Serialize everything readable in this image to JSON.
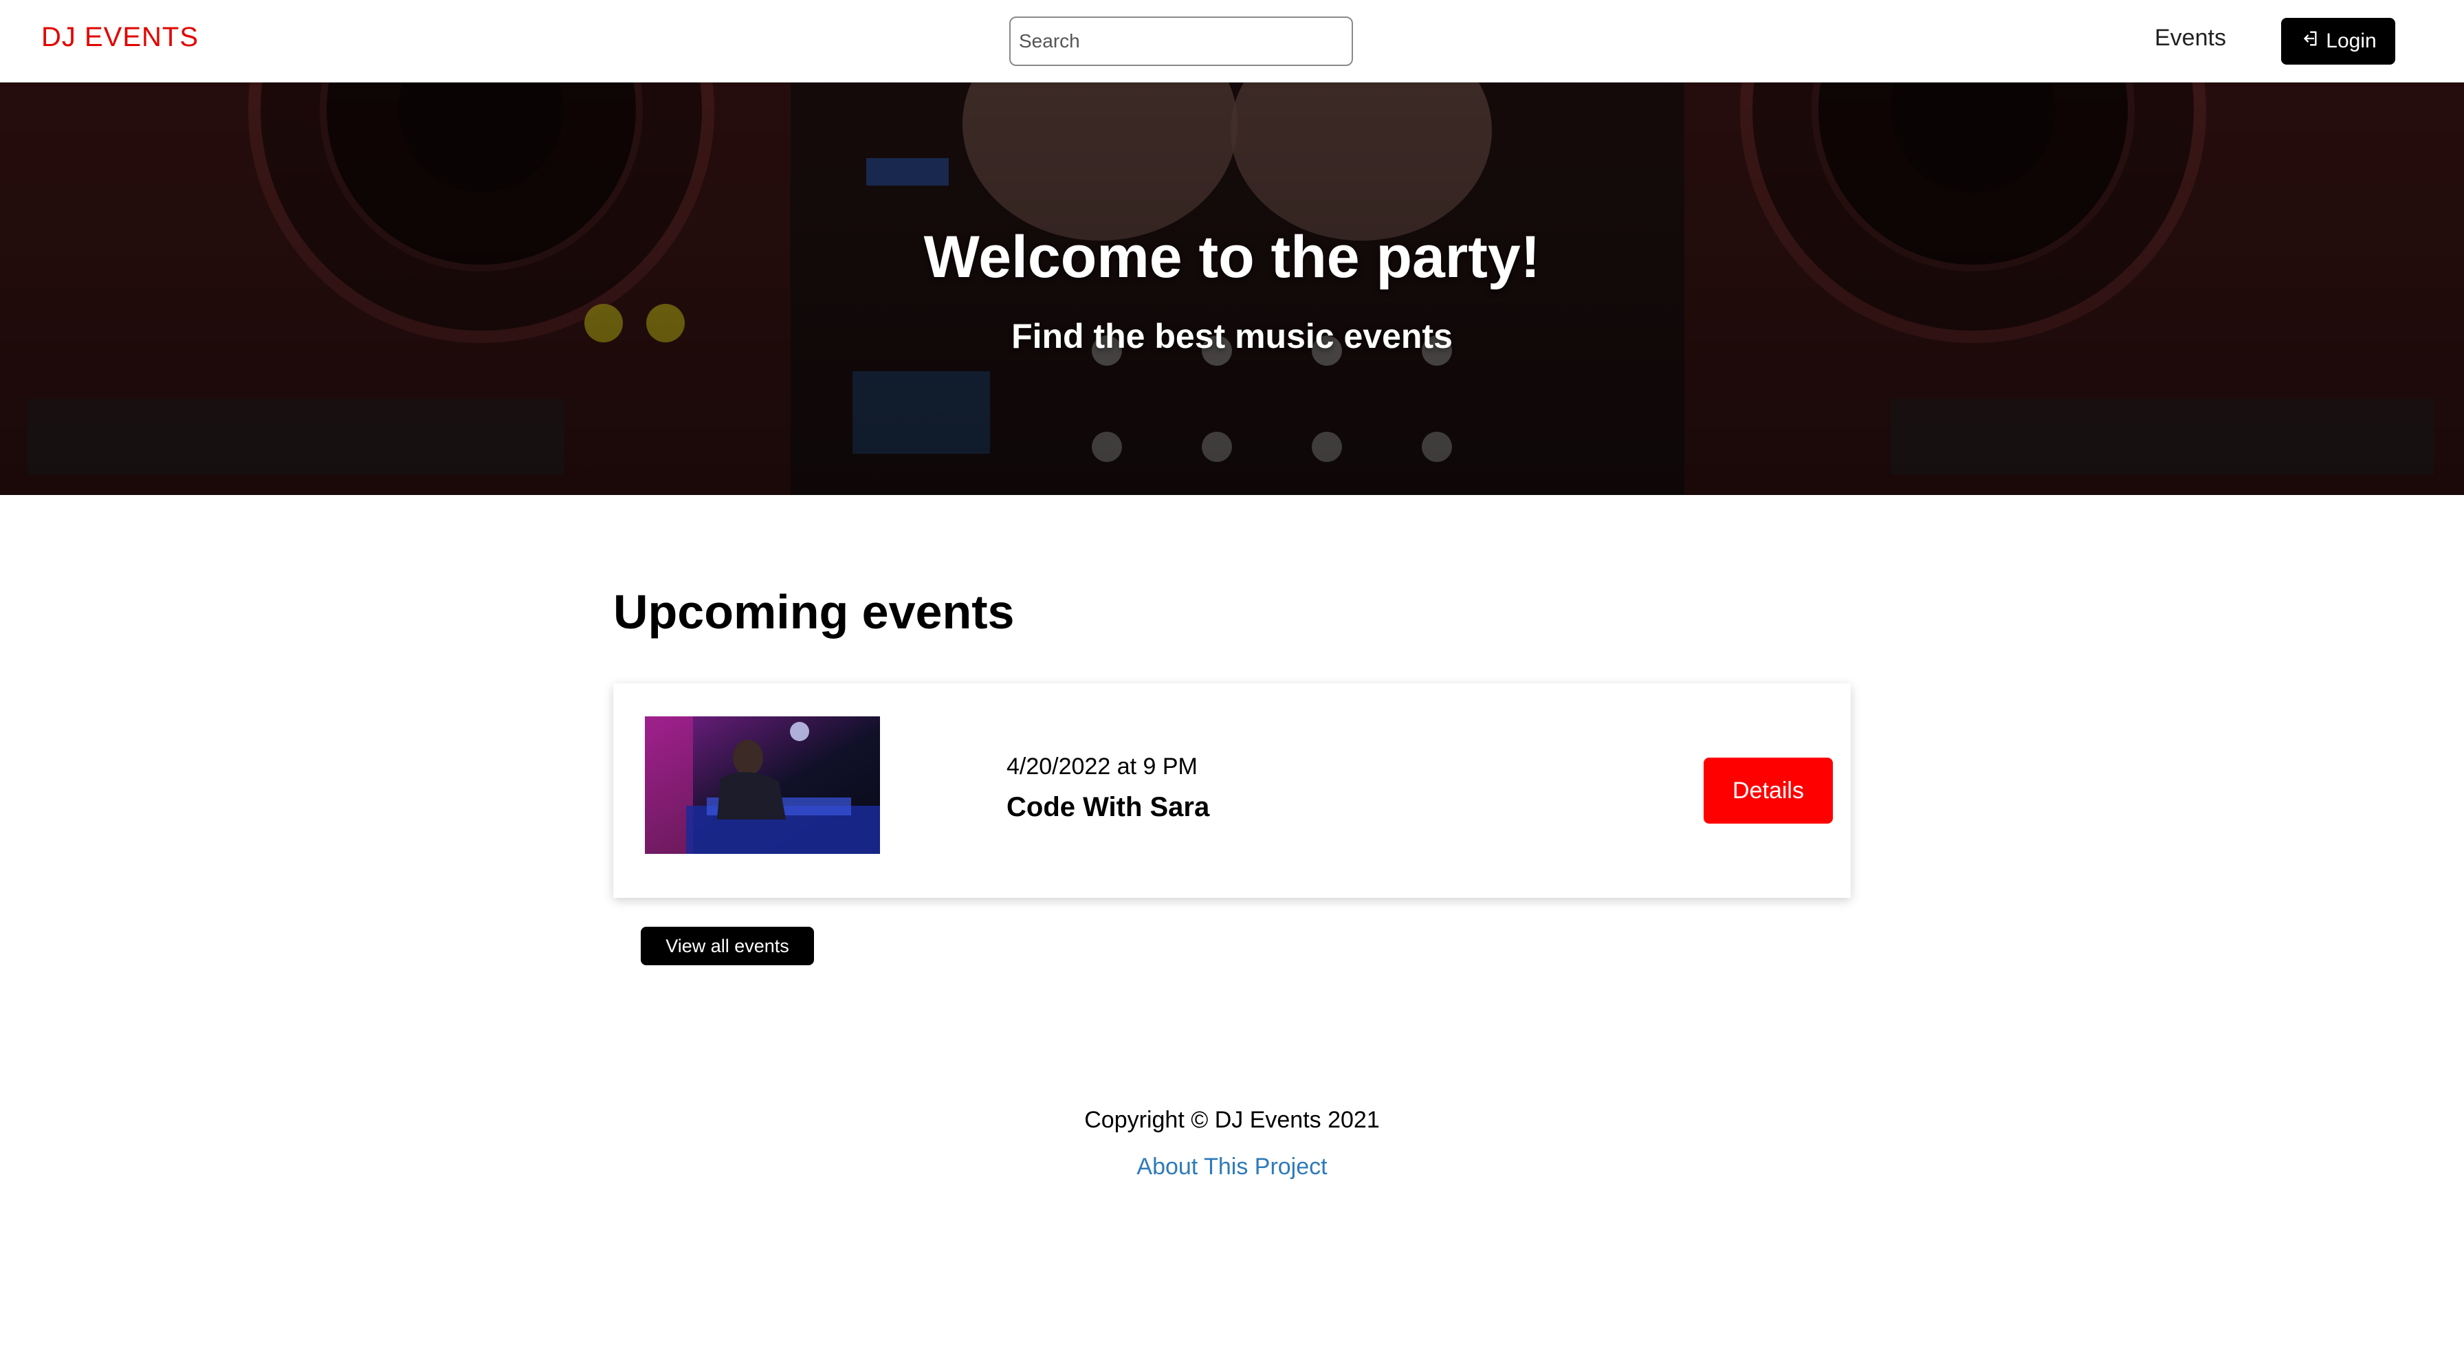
{
  "header": {
    "logo": "DJ EVENTS",
    "search_placeholder": "Search",
    "nav_events": "Events",
    "login_label": "Login"
  },
  "hero": {
    "title": "Welcome to the party!",
    "subtitle": "Find the best music events"
  },
  "main": {
    "section_title": "Upcoming events",
    "events": [
      {
        "date": "4/20/2022 at 9 PM",
        "name": "Code With Sara",
        "details_label": "Details"
      }
    ],
    "view_all_label": "View all events"
  },
  "footer": {
    "copyright": "Copyright © DJ Events 2021",
    "about_link": "About This Project"
  },
  "colors": {
    "brand_red": "#e10600",
    "details_red": "#ff0000",
    "link_blue": "#2f7ab9",
    "button_black": "#000000"
  },
  "icons": {
    "login": "sign-in-icon"
  }
}
